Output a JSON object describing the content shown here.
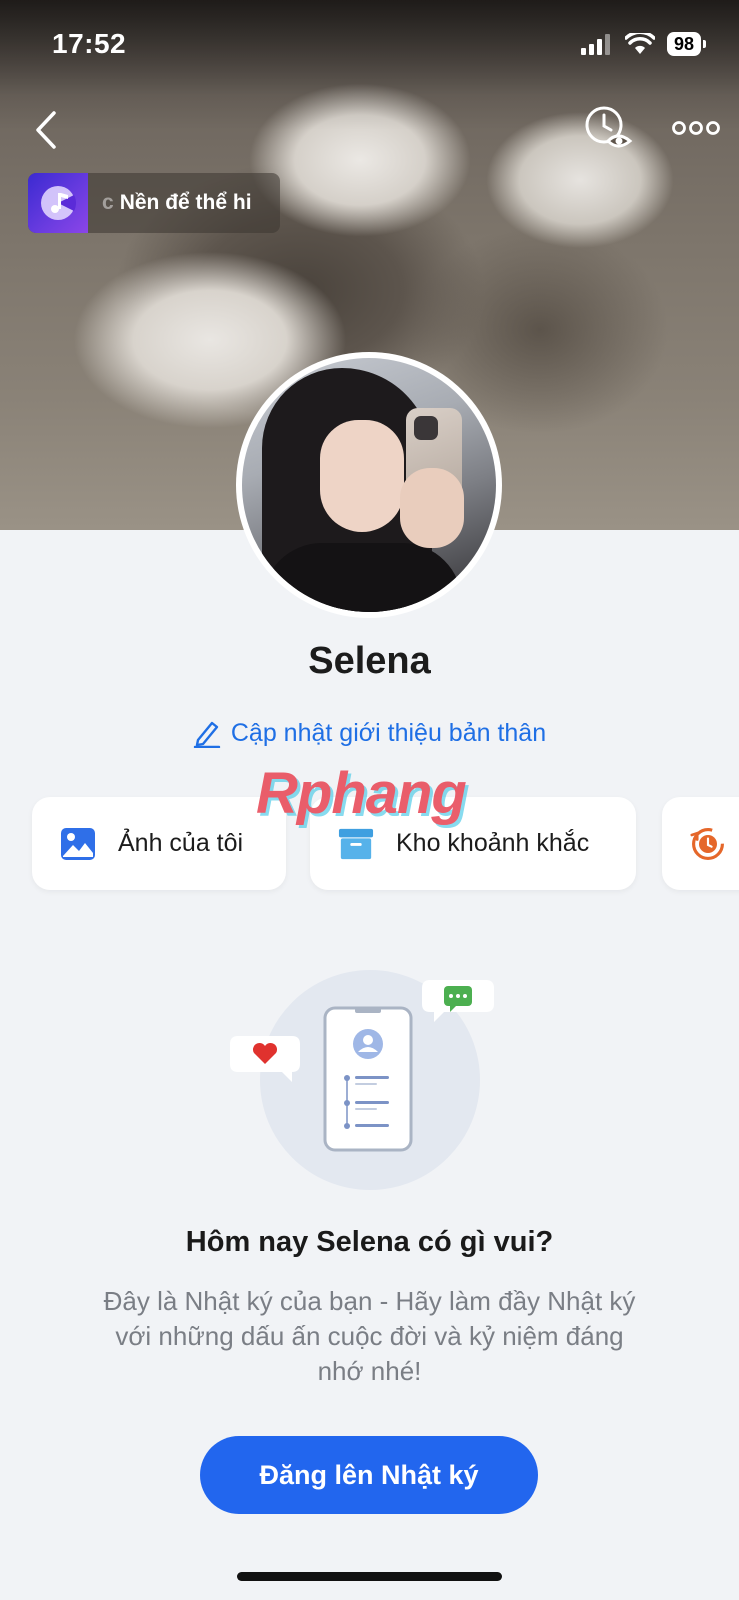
{
  "status_bar": {
    "time": "17:52",
    "battery": "98"
  },
  "header": {
    "back_icon": "chevron-left-icon",
    "visit_icon": "clock-eye-icon",
    "more_icon": "more-dots-icon"
  },
  "music": {
    "prefix": "c",
    "title": "Nền để thể hi"
  },
  "profile": {
    "name": "Selena",
    "update_bio_label": "Cập nhật giới thiệu bản thân"
  },
  "watermark": "Rphang",
  "shortcuts": [
    {
      "label": "Ảnh của tôi",
      "icon": "image-icon"
    },
    {
      "label": "Kho khoảnh khắc",
      "icon": "archive-box-icon"
    },
    {
      "label": "",
      "icon": "memory-clock-icon"
    }
  ],
  "empty_state": {
    "title": "Hôm nay Selena có gì vui?",
    "description": "Đây là Nhật ký của bạn - Hãy làm đầy Nhật ký với những dấu ấn cuộc đời và kỷ niệm đáng nhớ nhé!",
    "button_label": "Đăng lên Nhật ký"
  },
  "colors": {
    "accent": "#2266ee",
    "link": "#1f6fe5",
    "heart": "#e0322e",
    "chat": "#4caf50",
    "memory": "#e5672a"
  }
}
